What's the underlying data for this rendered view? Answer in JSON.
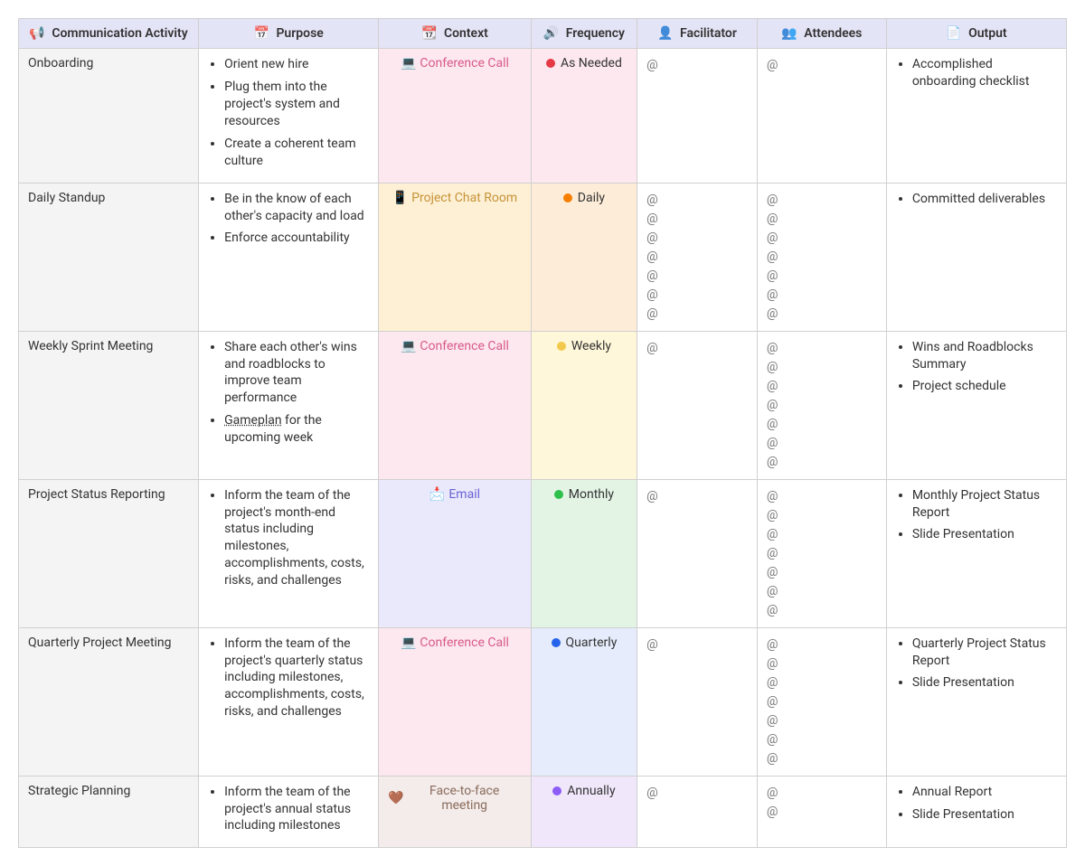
{
  "headers": {
    "activity": "Communication Activity",
    "purpose": "Purpose",
    "context": "Context",
    "frequency": "Frequency",
    "facilitator": "Facilitator",
    "attendees": "Attendees",
    "output": "Output"
  },
  "header_icons": {
    "activity": "📢",
    "purpose": "📅",
    "context": "📆",
    "frequency": "🔊",
    "facilitator": "👤",
    "attendees": "👥",
    "output": "📄"
  },
  "context_styles": {
    "Conference Call": {
      "icon": "💻",
      "bg": "#fde8ef",
      "color": "#d85a8a"
    },
    "Project Chat Room": {
      "icon": "📱",
      "bg": "#fdf0d5",
      "color": "#c79338"
    },
    "Email": {
      "icon": "📩",
      "bg": "#eae8fb",
      "color": "#6a63d6"
    },
    "Face-to-face meeting": {
      "icon": "🤎",
      "bg": "#f3ecea",
      "color": "#8a6b5c"
    }
  },
  "frequency_styles": {
    "As Needed": {
      "bg": "#fde8ef",
      "dot": "#e63946"
    },
    "Daily": {
      "bg": "#fdecd8",
      "dot": "#f77f00"
    },
    "Weekly": {
      "bg": "#fff7d9",
      "dot": "#f2c94c"
    },
    "Monthly": {
      "bg": "#e3f4e5",
      "dot": "#2fbf4b"
    },
    "Quarterly": {
      "bg": "#e6ecfb",
      "dot": "#2563eb"
    },
    "Annually": {
      "bg": "#f1e7fb",
      "dot": "#8b5cf6"
    }
  },
  "rows": [
    {
      "activity": "Onboarding",
      "purpose": [
        "Orient new hire",
        "Plug them into the project's system and resources",
        "Create a coherent team culture"
      ],
      "context": "Conference Call",
      "frequency": "As Needed",
      "facilitator_count": 1,
      "attendees_count": 1,
      "output": [
        "Accomplished onboarding checklist"
      ]
    },
    {
      "activity": "Daily Standup",
      "purpose": [
        "Be in the know of each other's capacity and load",
        "Enforce accountability"
      ],
      "context": "Project Chat Room",
      "frequency": "Daily",
      "facilitator_count": 7,
      "attendees_count": 7,
      "output": [
        "Committed deliverables"
      ]
    },
    {
      "activity": "Weekly Sprint Meeting",
      "purpose": [
        "Share each other's wins and roadblocks to improve team performance",
        "<u>Gameplan</u> for the upcoming week"
      ],
      "context": "Conference Call",
      "frequency": "Weekly",
      "facilitator_count": 1,
      "attendees_count": 7,
      "output": [
        "Wins and Roadblocks Summary",
        "Project schedule"
      ]
    },
    {
      "activity": "Project Status Reporting",
      "purpose": [
        "Inform the team of the project's month-end status including milestones, accomplishments, costs, risks, and challenges"
      ],
      "context": "Email",
      "frequency": "Monthly",
      "facilitator_count": 1,
      "attendees_count": 7,
      "output": [
        "Monthly Project Status Report",
        "Slide Presentation"
      ]
    },
    {
      "activity": "Quarterly Project Meeting",
      "purpose": [
        "Inform the team of the project's quarterly status including milestones, accomplishments, costs, risks, and challenges"
      ],
      "context": "Conference Call",
      "frequency": "Quarterly",
      "facilitator_count": 1,
      "attendees_count": 7,
      "output": [
        "Quarterly Project Status Report",
        "Slide Presentation"
      ]
    },
    {
      "activity": "Strategic Planning",
      "purpose": [
        "Inform the team of the project's annual status including milestones"
      ],
      "context": "Face-to-face meeting",
      "frequency": "Annually",
      "facilitator_count": 1,
      "attendees_count": 2,
      "output": [
        "Annual Report",
        "Slide Presentation"
      ]
    }
  ]
}
